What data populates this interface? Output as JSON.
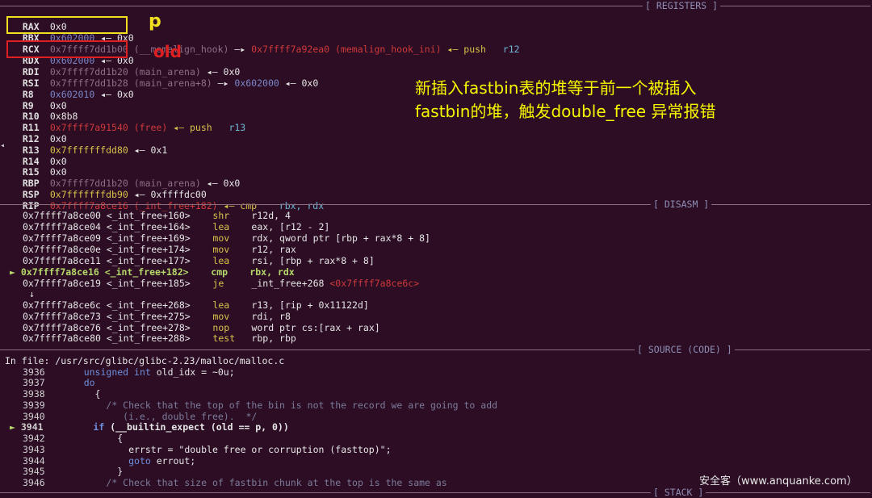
{
  "sections": {
    "registers": "[ REGISTERS ]",
    "disasm": "[ DISASM ]",
    "source": "[ SOURCE (CODE) ]",
    "stack": "[ STACK ]"
  },
  "registers": {
    "rax": {
      "name": "RAX",
      "value": "0x0"
    },
    "rbx": {
      "name": "RBX",
      "addr": "0x602000",
      "arrow": "◂— 0x0"
    },
    "rcx": {
      "name": "RCX",
      "addr": "0x7ffff7dd1b00",
      "sym": "(__memalign_hook)",
      "arrow1": "—▸",
      "addr2": "0x7ffff7a92ea0 (memalign_hook_ini)",
      "arrow2": "◂— push",
      "arg": "r12"
    },
    "rdx": {
      "name": "RDX",
      "addr": "0x602000",
      "arrow": "◂— 0x0"
    },
    "rdi": {
      "name": "RDI",
      "addr": "0x7ffff7dd1b20",
      "sym": "(main_arena)",
      "arrow": "◂— 0x0"
    },
    "rsi": {
      "name": "RSI",
      "addr": "0x7ffff7dd1b28",
      "sym": "(main_arena+8)",
      "arrow1": "—▸",
      "addr2": "0x602000",
      "arrow2": "◂— 0x0"
    },
    "r8": {
      "name": "R8",
      "addr": "0x602010",
      "arrow": "◂— 0x0"
    },
    "r9": {
      "name": "R9",
      "value": "0x0"
    },
    "r10": {
      "name": "R10",
      "value": "0x8b8"
    },
    "r11": {
      "name": "R11",
      "addr": "0x7ffff7a91540 (free)",
      "arrow": "◂— push",
      "arg": "r13"
    },
    "r12": {
      "name": "R12",
      "value": "0x0"
    },
    "r13": {
      "name": "R13",
      "addr": "0x7fffffffdd80",
      "arrow": "◂— 0x1"
    },
    "r14": {
      "name": "R14",
      "value": "0x0"
    },
    "r15": {
      "name": "R15",
      "value": "0x0"
    },
    "rbp": {
      "name": "RBP",
      "addr": "0x7ffff7dd1b20",
      "sym": "(main_arena)",
      "arrow": "◂— 0x0"
    },
    "rsp": {
      "name": "RSP",
      "addr": "0x7fffffffdb90",
      "arrow": "◂— 0xffffdc00"
    },
    "rip": {
      "name": "RIP",
      "addr": "0x7ffff7a8ce16 (_int_free+182)",
      "arrow": "◂— cmp",
      "arg": "rbx, rdx"
    }
  },
  "disasm": [
    {
      "addr": "0x7ffff7a8ce00 <_int_free+160>",
      "op": "shr",
      "args": "r12d, 4"
    },
    {
      "addr": "0x7ffff7a8ce04 <_int_free+164>",
      "op": "lea",
      "args": "eax, [r12 - 2]"
    },
    {
      "addr": "0x7ffff7a8ce09 <_int_free+169>",
      "op": "mov",
      "args": "rdx, qword ptr [rbp + rax*8 + 8]"
    },
    {
      "addr": "0x7ffff7a8ce0e <_int_free+174>",
      "op": "mov",
      "args": "r12, rax"
    },
    {
      "addr": "0x7ffff7a8ce11 <_int_free+177>",
      "op": "lea",
      "args": "rsi, [rbp + rax*8 + 8]"
    },
    {
      "addr": "0x7ffff7a8ce16 <_int_free+182>",
      "op": "cmp",
      "args": "rbx, rdx",
      "current": true
    },
    {
      "addr": "0x7ffff7a8ce19 <_int_free+185>",
      "op": "je",
      "args": "_int_free+268",
      "target": "<0x7ffff7a8ce6c>"
    },
    {
      "addr": "0x7ffff7a8ce6c <_int_free+268>",
      "op": "lea",
      "args": "r13, [rip + 0x11122d]"
    },
    {
      "addr": "0x7ffff7a8ce73 <_int_free+275>",
      "op": "mov",
      "args": "rdi, r8"
    },
    {
      "addr": "0x7ffff7a8ce76 <_int_free+278>",
      "op": "nop",
      "args": "word ptr cs:[rax + rax]"
    },
    {
      "addr": "0x7ffff7a8ce80 <_int_free+288>",
      "op": "test",
      "args": "rbp, rbp"
    }
  ],
  "disasm_marker": "►",
  "disasm_down_arrow": "↓",
  "source": {
    "file_line": "In file: /usr/src/glibc/glibc-2.23/malloc/malloc.c",
    "lines": [
      {
        "num": "3936",
        "text_kw": "unsigned int",
        "text": " old_idx = ~0u;"
      },
      {
        "num": "3937",
        "text_kw": "do",
        "text": ""
      },
      {
        "num": "3938",
        "text": "{"
      },
      {
        "num": "3939",
        "comment": "/* Check that the top of the bin is not the record we are going to add"
      },
      {
        "num": "3940",
        "comment": "   (i.e., double free).  */"
      },
      {
        "num": "3941",
        "text_kw": "if",
        "text": " (__builtin_expect (old == p, 0))",
        "current": true
      },
      {
        "num": "3942",
        "text": "{"
      },
      {
        "num": "3943",
        "text": "errstr = \"double free or corruption (fasttop)\";"
      },
      {
        "num": "3944",
        "text_kw": "goto",
        "text": " errout;"
      },
      {
        "num": "3945",
        "text": "}"
      },
      {
        "num": "3946",
        "comment": "/* Check that size of fastbin chunk at the top is the same as"
      }
    ]
  },
  "annotations": {
    "p_label": "p",
    "old_label": "old",
    "cn_line1": "新插入fastbin表的堆等于前一个被插入",
    "cn_line2": "fastbin的堆，触发double_free 异常报错",
    "watermark": "安全客（www.anquanke.com）"
  },
  "colors": {
    "background": "#2c0d24",
    "yellow_box": "#f0e020",
    "red_box": "#e02020",
    "annotation_text": "#f6f600"
  }
}
